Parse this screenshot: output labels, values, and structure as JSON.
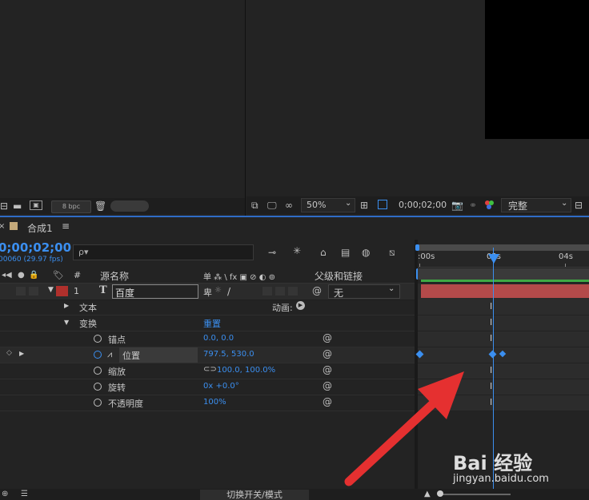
{
  "top": {
    "bpc_label": "8 bpc",
    "zoom_value": "50%",
    "timecode_small": "0;00;02;00",
    "quality_value": "完整"
  },
  "comp": {
    "tab_label": "合成1",
    "menu_icon": "hamburger-icon",
    "timecode": "0;00;02;00",
    "frames_fps": "00060 (29.97 fps)",
    "search_placeholder": "ρ▾"
  },
  "columns": {
    "hash": "#",
    "source_name": "源名称",
    "switches": "单 ⁂ \\ fx ▣ ⊘ ◐ ⊚",
    "parent": "父级和链接"
  },
  "layer": {
    "number": "1",
    "type_glyph": "T",
    "name": "百度",
    "parent_value": "无",
    "label_color": "#b0302c"
  },
  "props": {
    "text_label": "文本",
    "animate_label": "动画:",
    "transform_label": "变换",
    "reset_label": "重置",
    "anchor_label": "锚点",
    "anchor_value": "0.0, 0.0",
    "position_label": "位置",
    "position_value": "797.5, 530.0",
    "scale_label": "缩放",
    "scale_value": "100.0, 100.0%",
    "rotation_label": "旋转",
    "rotation_value": "0x +0.0°",
    "opacity_label": "不透明度",
    "opacity_value": "100%"
  },
  "timeline": {
    "tick_0": ":00s",
    "tick_2": "02s",
    "tick_4": "04s",
    "bar_color": "#b44a4a",
    "playhead_color": "#3b8ff0"
  },
  "bottom": {
    "toggle_label": "切换开关/模式"
  },
  "watermark": {
    "brand": "Bai 经验",
    "url": "jingyan.baidu.com"
  }
}
